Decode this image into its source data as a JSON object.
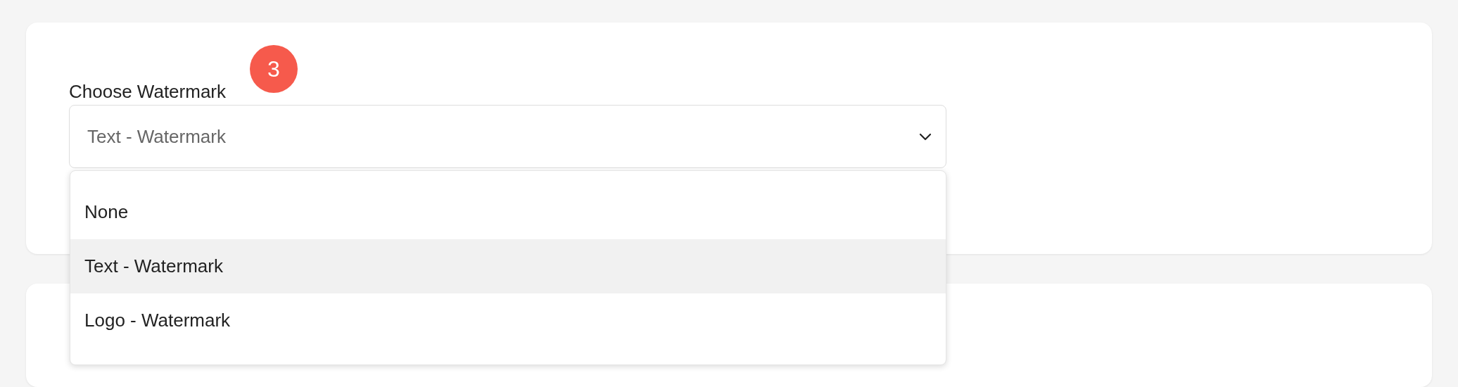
{
  "field": {
    "label": "Choose Watermark",
    "badge": "3",
    "value": "Text - Watermark",
    "expanded": true
  },
  "options": [
    {
      "label": "None",
      "selected": false
    },
    {
      "label": "Text - Watermark",
      "selected": true
    },
    {
      "label": "Logo - Watermark",
      "selected": false
    }
  ]
}
